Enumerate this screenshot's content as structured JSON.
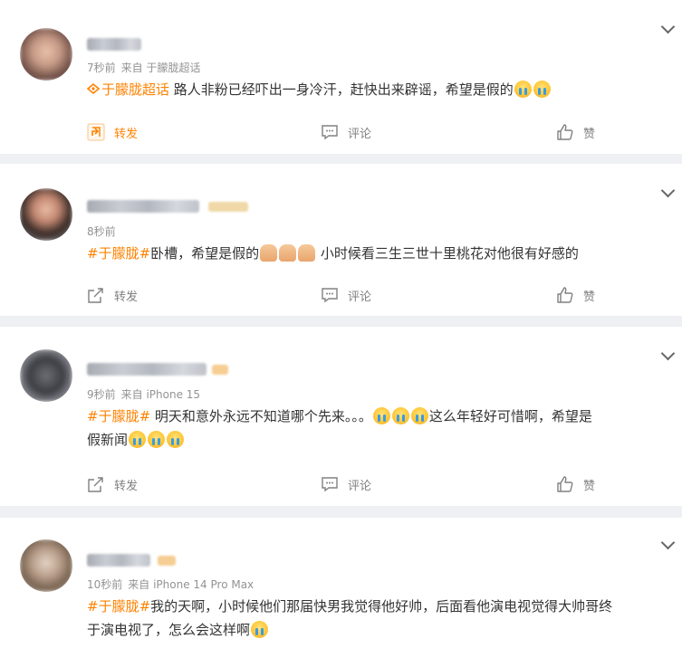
{
  "comments": [
    {
      "time": "7秒前",
      "source": "来自 于朦胧超话",
      "tag": "于朦胧超话",
      "text": " 路人非粉已经吓出一身冷汗，赶快出来辟谣，希望是假的",
      "emojis": [
        "crying-face",
        "crying-face"
      ]
    },
    {
      "time": "8秒前",
      "source": "",
      "tag": "#于朦胧#",
      "text": "卧槽，希望是假的",
      "emojis": [
        "pray",
        "pray",
        "pray"
      ],
      "text2": " 小时候看三生三世十里桃花对他很有好感的"
    },
    {
      "time": "9秒前",
      "source": "来自 iPhone 15",
      "tag": "#于朦胧#",
      "text": " 明天和意外永远不知道哪个先来。。。",
      "emojis": [
        "crying-face",
        "crying-face",
        "crying-face"
      ],
      "text2": "这么年轻好可惜啊，希望是",
      "text3": "假新闻",
      "emojis2": [
        "crying-face",
        "crying-face",
        "crying-face"
      ]
    },
    {
      "time": "10秒前",
      "source": "来自 iPhone 14 Pro Max",
      "tag": "#于朦胧#",
      "text": "我的天啊，小时候他们那届快男我觉得他好帅，后面看他演电视觉得大帅哥终",
      "text2": "于演电视了，怎么会这样啊",
      "emojis": [
        "crying-face"
      ]
    }
  ],
  "actions": {
    "repost": "转发",
    "comment": "评论",
    "like": "赞"
  },
  "colors": {
    "accent": "#ff8200",
    "meta": "#939393",
    "background": "#eef0f3"
  }
}
